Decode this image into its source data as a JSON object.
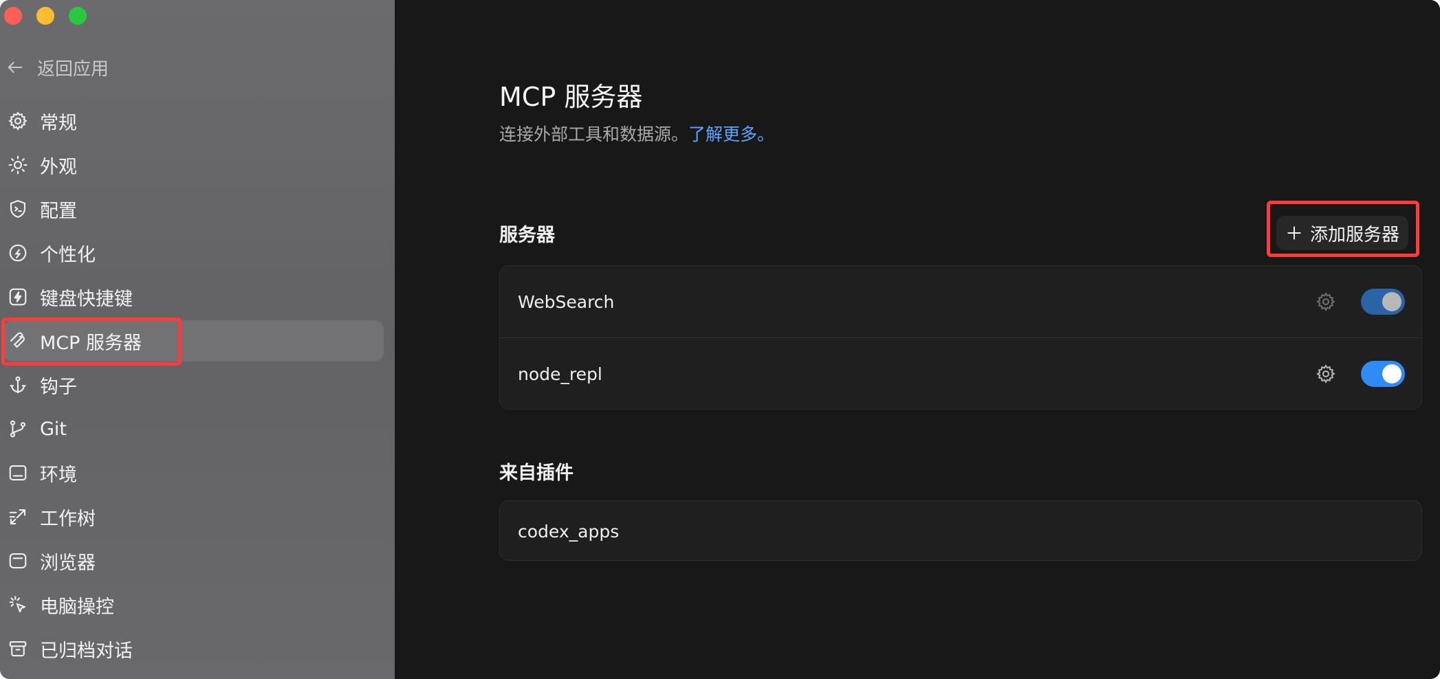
{
  "sidebar": {
    "back_label": "返回应用",
    "items": [
      {
        "label": "常规",
        "icon": "gear-icon"
      },
      {
        "label": "外观",
        "icon": "sun-icon"
      },
      {
        "label": "配置",
        "icon": "shield-terminal-icon"
      },
      {
        "label": "个性化",
        "icon": "personalize-icon"
      },
      {
        "label": "键盘快捷键",
        "icon": "lightning-icon"
      },
      {
        "label": "MCP 服务器",
        "icon": "mcp-icon",
        "active": true
      },
      {
        "label": "钩子",
        "icon": "anchor-icon"
      },
      {
        "label": "Git",
        "icon": "git-branch-icon"
      },
      {
        "label": "环境",
        "icon": "terminal-window-icon"
      },
      {
        "label": "工作树",
        "icon": "worktree-icon"
      },
      {
        "label": "浏览器",
        "icon": "browser-icon"
      },
      {
        "label": "电脑操控",
        "icon": "cursor-click-icon"
      },
      {
        "label": "已归档对话",
        "icon": "archive-icon"
      }
    ]
  },
  "main": {
    "title": "MCP 服务器",
    "subtitle": "连接外部工具和数据源。",
    "learn_more": "了解更多。",
    "servers_heading": "服务器",
    "add_button": "添加服务器",
    "servers": [
      {
        "name": "WebSearch",
        "enabled": true,
        "state": "dimmed"
      },
      {
        "name": "node_repl",
        "enabled": true,
        "state": "on"
      }
    ],
    "plugins_heading": "来自插件",
    "plugins": [
      {
        "name": "codex_apps"
      }
    ]
  },
  "colors": {
    "highlight": "#ff3b3b",
    "accent": "#2f8bf5",
    "link": "#5ea4ff"
  }
}
